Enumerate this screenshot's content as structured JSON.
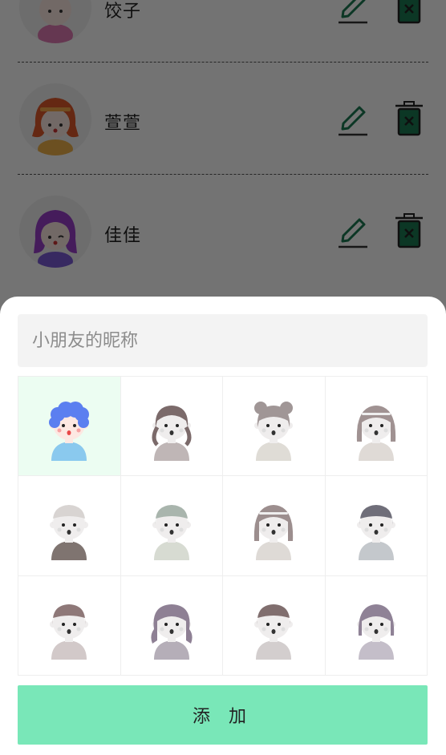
{
  "kids": [
    {
      "name": "饺子",
      "avatar_icon": "girl-pink-avatar-icon"
    },
    {
      "name": "萱萱",
      "avatar_icon": "girl-orange-hair-avatar-icon"
    },
    {
      "name": "佳佳",
      "avatar_icon": "girl-purple-hair-avatar-icon"
    }
  ],
  "row_actions": {
    "edit_icon": "pencil-icon",
    "delete_icon": "trash-icon"
  },
  "sheet": {
    "nickname_placeholder": "小朋友的昵称",
    "nickname_value": "",
    "add_label": "添 加",
    "selected_avatar_index": 0,
    "avatars": [
      {
        "name": "boy-blue-curly-avatar",
        "hair": "#5b7ff0",
        "shirt": "#8ac9ee",
        "style": "curly",
        "color": true
      },
      {
        "name": "girl-pigtails-avatar",
        "hair": "#7b6a6a",
        "shirt": "#bfb6b6",
        "style": "pigtails",
        "color": false
      },
      {
        "name": "girl-buns-avatar",
        "hair": "#a09696",
        "shirt": "#dfdcd6",
        "style": "buns",
        "color": false
      },
      {
        "name": "girl-headband-avatar",
        "hair": "#a09292",
        "shirt": "#dfdad6",
        "style": "long",
        "color": false
      },
      {
        "name": "boy-light-hair-avatar",
        "hair": "#d8d4d2",
        "shirt": "#7f7470",
        "style": "short",
        "color": false
      },
      {
        "name": "boy-grey-green-avatar",
        "hair": "#a9b5ad",
        "shirt": "#d7dbd2",
        "style": "short",
        "color": false
      },
      {
        "name": "girl-long-wink-avatar",
        "hair": "#9c8e8e",
        "shirt": "#dedad6",
        "style": "long",
        "color": false
      },
      {
        "name": "boy-dark-wink-avatar",
        "hair": "#6f6e79",
        "shirt": "#c4c8cc",
        "style": "short",
        "color": false
      },
      {
        "name": "boy-brown-wink-avatar",
        "hair": "#8e7878",
        "shirt": "#d2c9c9",
        "style": "short",
        "color": false
      },
      {
        "name": "girl-wavy-avatar",
        "hair": "#8e8094",
        "shirt": "#b5aeb8",
        "style": "wavy",
        "color": false
      },
      {
        "name": "boy-bowl-avatar",
        "hair": "#806e6e",
        "shirt": "#d3cece",
        "style": "short",
        "color": false
      },
      {
        "name": "girl-purple-bob-avatar",
        "hair": "#8f8296",
        "shirt": "#c4bec9",
        "style": "bob",
        "color": false
      }
    ]
  },
  "colors": {
    "accent": "#79e7b8",
    "selected_bg": "#ecfdf2",
    "icon_green": "#1c7a52",
    "overlay": "rgba(0,0,0,0.55)"
  }
}
